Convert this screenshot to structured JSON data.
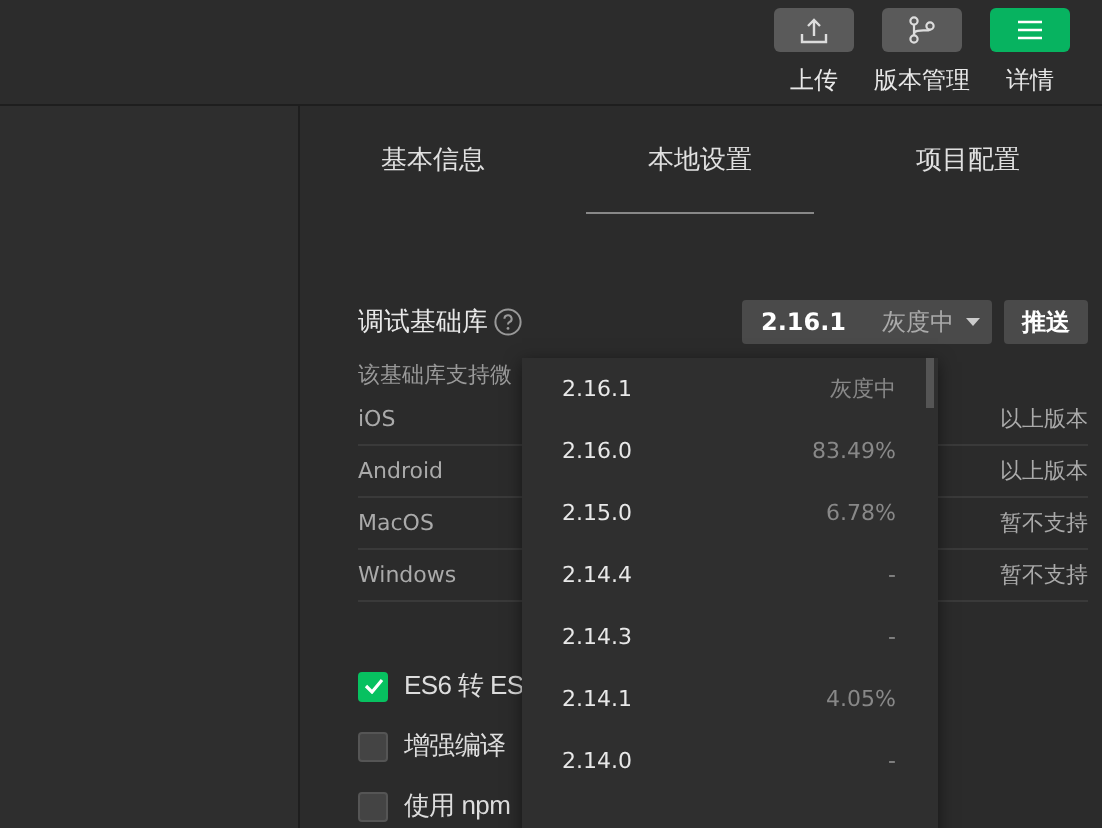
{
  "toolbar": [
    {
      "kind": "upload",
      "label": "上传",
      "selected": false
    },
    {
      "kind": "branch",
      "label": "版本管理",
      "selected": false
    },
    {
      "kind": "menu",
      "label": "详情",
      "selected": true
    }
  ],
  "tabs": [
    {
      "label": "基本信息",
      "selected": false
    },
    {
      "label": "本地设置",
      "selected": true
    },
    {
      "label": "项目配置",
      "selected": false
    }
  ],
  "library": {
    "label": "调试基础库",
    "version": "2.16.1",
    "status": "灰度中",
    "push": "推送"
  },
  "support": {
    "note": "该基础库支持微",
    "rows": [
      {
        "os": "iOS",
        "value": "以上版本"
      },
      {
        "os": "Android",
        "value": "以上版本"
      },
      {
        "os": "MacOS",
        "value": "暂不支持"
      },
      {
        "os": "Windows",
        "value": "暂不支持"
      }
    ]
  },
  "options": [
    {
      "label": "ES6 转 ES",
      "checked": true
    },
    {
      "label": "增强编译",
      "checked": false
    },
    {
      "label": "使用 npm",
      "checked": false
    }
  ],
  "dropdown": [
    {
      "version": "2.16.1",
      "info": "灰度中"
    },
    {
      "version": "2.16.0",
      "info": "83.49%"
    },
    {
      "version": "2.15.0",
      "info": "6.78%"
    },
    {
      "version": "2.14.4",
      "info": "-"
    },
    {
      "version": "2.14.3",
      "info": "-"
    },
    {
      "version": "2.14.1",
      "info": "4.05%"
    },
    {
      "version": "2.14.0",
      "info": "-"
    }
  ]
}
